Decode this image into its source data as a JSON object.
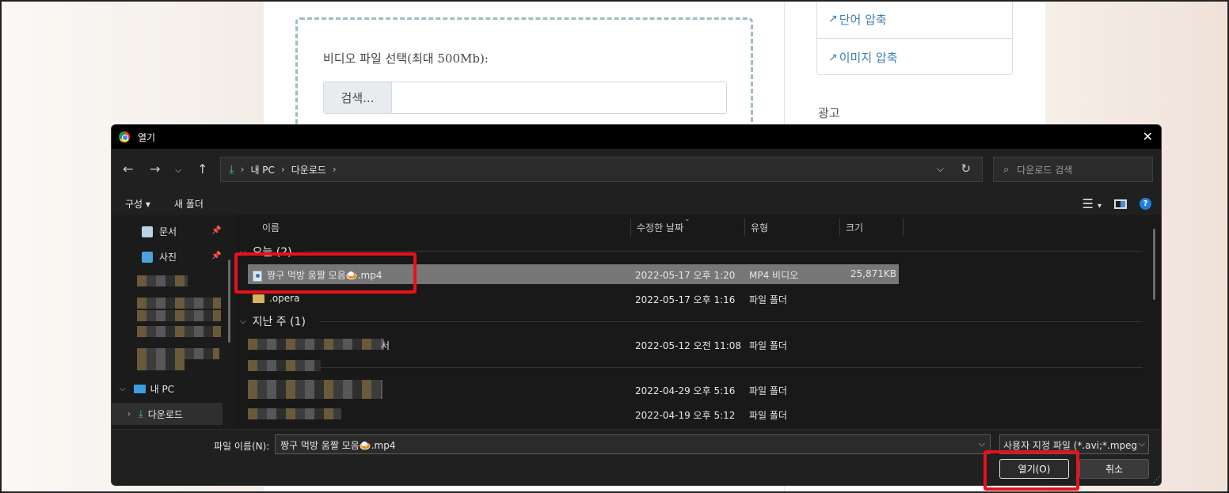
{
  "page": {
    "upload_label": "비디오 파일 선택(최대 500Mb):",
    "browse_label": "검색...",
    "side_links": [
      "단어 압축",
      "이미지 압축"
    ],
    "ad_label": "광고"
  },
  "dialog": {
    "title": "열기",
    "breadcrumb": [
      "내 PC",
      "다운로드"
    ],
    "search_placeholder": "다운로드 검색",
    "toolbar": {
      "organize": "구성 ▾",
      "new_folder": "새 폴더"
    },
    "nav": {
      "quick": [
        {
          "label": "문서",
          "icon": "document-icon"
        },
        {
          "label": "사진",
          "icon": "picture-icon"
        }
      ],
      "this_pc": "내 PC",
      "downloads": "다운로드"
    },
    "columns": {
      "name": "이름",
      "modified": "수정한 날짜",
      "type": "유형",
      "size": "크기"
    },
    "groups": {
      "today": "오늘 (2)",
      "last_week": "지난 주 (1)"
    },
    "rows": [
      {
        "name": "짱구 먹방 움짤 모음🍛.mp4",
        "modified": "2022-05-17 오후 1:20",
        "type": "MP4 비디오",
        "size": "25,871KB"
      },
      {
        "name": ".opera",
        "modified": "2022-05-17 오후 1:16",
        "type": "파일 폴더",
        "size": ""
      },
      {
        "name": "서",
        "modified": "2022-05-12 오전 11:08",
        "type": "파일 폴더",
        "size": ""
      },
      {
        "name": "",
        "modified": "2022-04-29 오후 5:16",
        "type": "파일 폴더",
        "size": ""
      },
      {
        "name": "",
        "modified": "2022-04-19 오후 5:12",
        "type": "파일 폴더",
        "size": ""
      }
    ],
    "filename_label": "파일 이름(N):",
    "filename_value": "짱구 먹방 움짤 모음🍛.mp4",
    "filetype_value": "사용자 지정 파일 (*.avi;*.mpeg",
    "open_button": "열기(O)",
    "cancel_button": "취소"
  },
  "colors": {
    "highlight": "#e8101c",
    "accent": "#3fbf93",
    "link": "#3e7fb3"
  }
}
